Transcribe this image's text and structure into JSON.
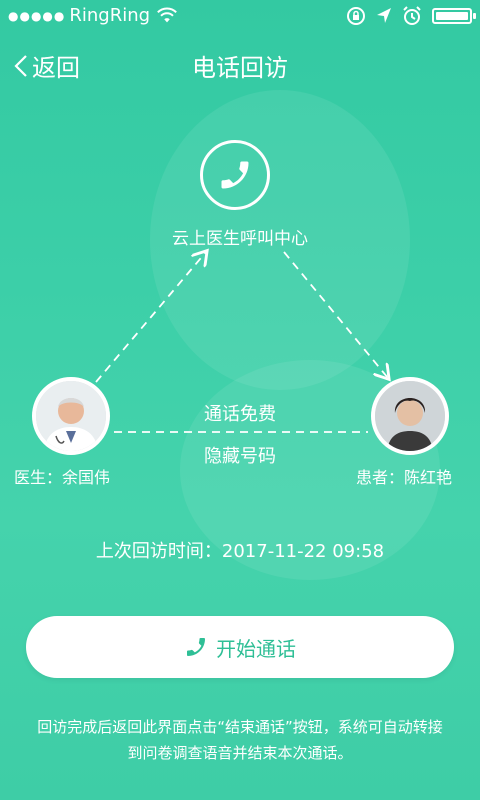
{
  "status_bar": {
    "signal_dots": "●●●●●",
    "carrier": "RingRing",
    "icons": [
      "wifi-icon",
      "lock-rotation-icon",
      "location-icon",
      "alarm-icon",
      "battery-icon"
    ]
  },
  "nav": {
    "back_label": "返回",
    "title": "电话回访"
  },
  "diagram": {
    "center_label": "云上医生呼叫中心",
    "doctor_label": "医生：余国伟",
    "patient_label": "患者：陈红艳",
    "free_label": "通话免费",
    "hidden_label": "隐藏号码"
  },
  "last_visit": "上次回访时间：2017-11-22 09:58",
  "call_button": {
    "label": "开始通话",
    "icon": "phone-icon"
  },
  "note": "回访完成后返回此界面点击“结束通话”按钮，系统可自动转接到问卷调查语音并结束本次通话。",
  "colors": {
    "background": "#3ccfa8",
    "accent": "#2fbf96",
    "text": "#ffffff"
  }
}
